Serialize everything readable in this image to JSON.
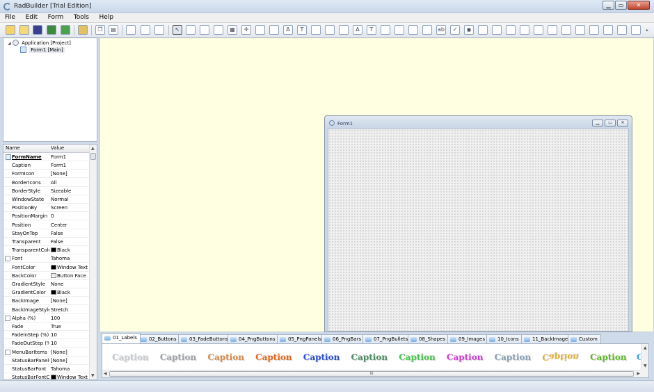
{
  "window": {
    "title": "RadBuilder [Trial Edition]"
  },
  "menu": [
    "File",
    "Edit",
    "Form",
    "Tools",
    "Help"
  ],
  "tree": {
    "root": "Application [Project]",
    "child": "Form1 [Main]"
  },
  "props": {
    "col_name": "Name",
    "col_value": "Value",
    "rows": [
      {
        "n": "FormName",
        "v": "Form1"
      },
      {
        "n": "Caption",
        "v": "Form1"
      },
      {
        "n": "FormIcon",
        "v": "[None]"
      },
      {
        "n": "BorderIcons",
        "v": "All"
      },
      {
        "n": "BorderStyle",
        "v": "Sizeable"
      },
      {
        "n": "WindowState",
        "v": "Normal"
      },
      {
        "n": "PositionBy",
        "v": "Screen"
      },
      {
        "n": "PositionMargin",
        "v": "0"
      },
      {
        "n": "Position",
        "v": "Center"
      },
      {
        "n": "StayOnTop",
        "v": "False"
      },
      {
        "n": "Transparent",
        "v": "False"
      },
      {
        "n": "TransparentColor",
        "v": "Black"
      },
      {
        "n": "Font",
        "v": "Tahoma"
      },
      {
        "n": "FontColor",
        "v": "Window Text"
      },
      {
        "n": "BackColor",
        "v": "Button Face"
      },
      {
        "n": "GradientStyle",
        "v": "None"
      },
      {
        "n": "GradientColor",
        "v": "Black"
      },
      {
        "n": "BackImage",
        "v": "[None]"
      },
      {
        "n": "BackImageStyle",
        "v": "Stretch"
      },
      {
        "n": "Alpha (%)",
        "v": "100"
      },
      {
        "n": "Fade",
        "v": "True"
      },
      {
        "n": "FadeInStep (%)",
        "v": "10"
      },
      {
        "n": "FadeOutStep (%)",
        "v": "10"
      },
      {
        "n": "MenuBarItems",
        "v": "[None]"
      },
      {
        "n": "StatusBarPanels",
        "v": "[None]"
      },
      {
        "n": "StatusBarFont",
        "v": "Tahoma"
      },
      {
        "n": "StatusBarFontColor",
        "v": "Window Text"
      }
    ]
  },
  "form": {
    "title": "Form1"
  },
  "tabs": [
    "01_Labels",
    "02_Buttons",
    "03_FadeButtons",
    "04_PngButtons",
    "05_PngPanels",
    "06_PngBars",
    "07_PngBullets",
    "08_Shapes",
    "09_Images",
    "10_Icons",
    "11_BackImages",
    "Custom"
  ],
  "palette": {
    "caption": "Caption",
    "scroll_grip": "III",
    "colors": [
      "#c9ccd1",
      "#9ea2a8",
      "#d98a4a",
      "#e4661c",
      "#2b4fcf",
      "#4d8c63",
      "#47c24a",
      "#d23cd6",
      "#8aa0b6",
      "#e2b23c",
      "#61b82a"
    ]
  },
  "colors": {
    "swatch_black": "#000000",
    "swatch_buttonface": "#f0f0f0"
  }
}
